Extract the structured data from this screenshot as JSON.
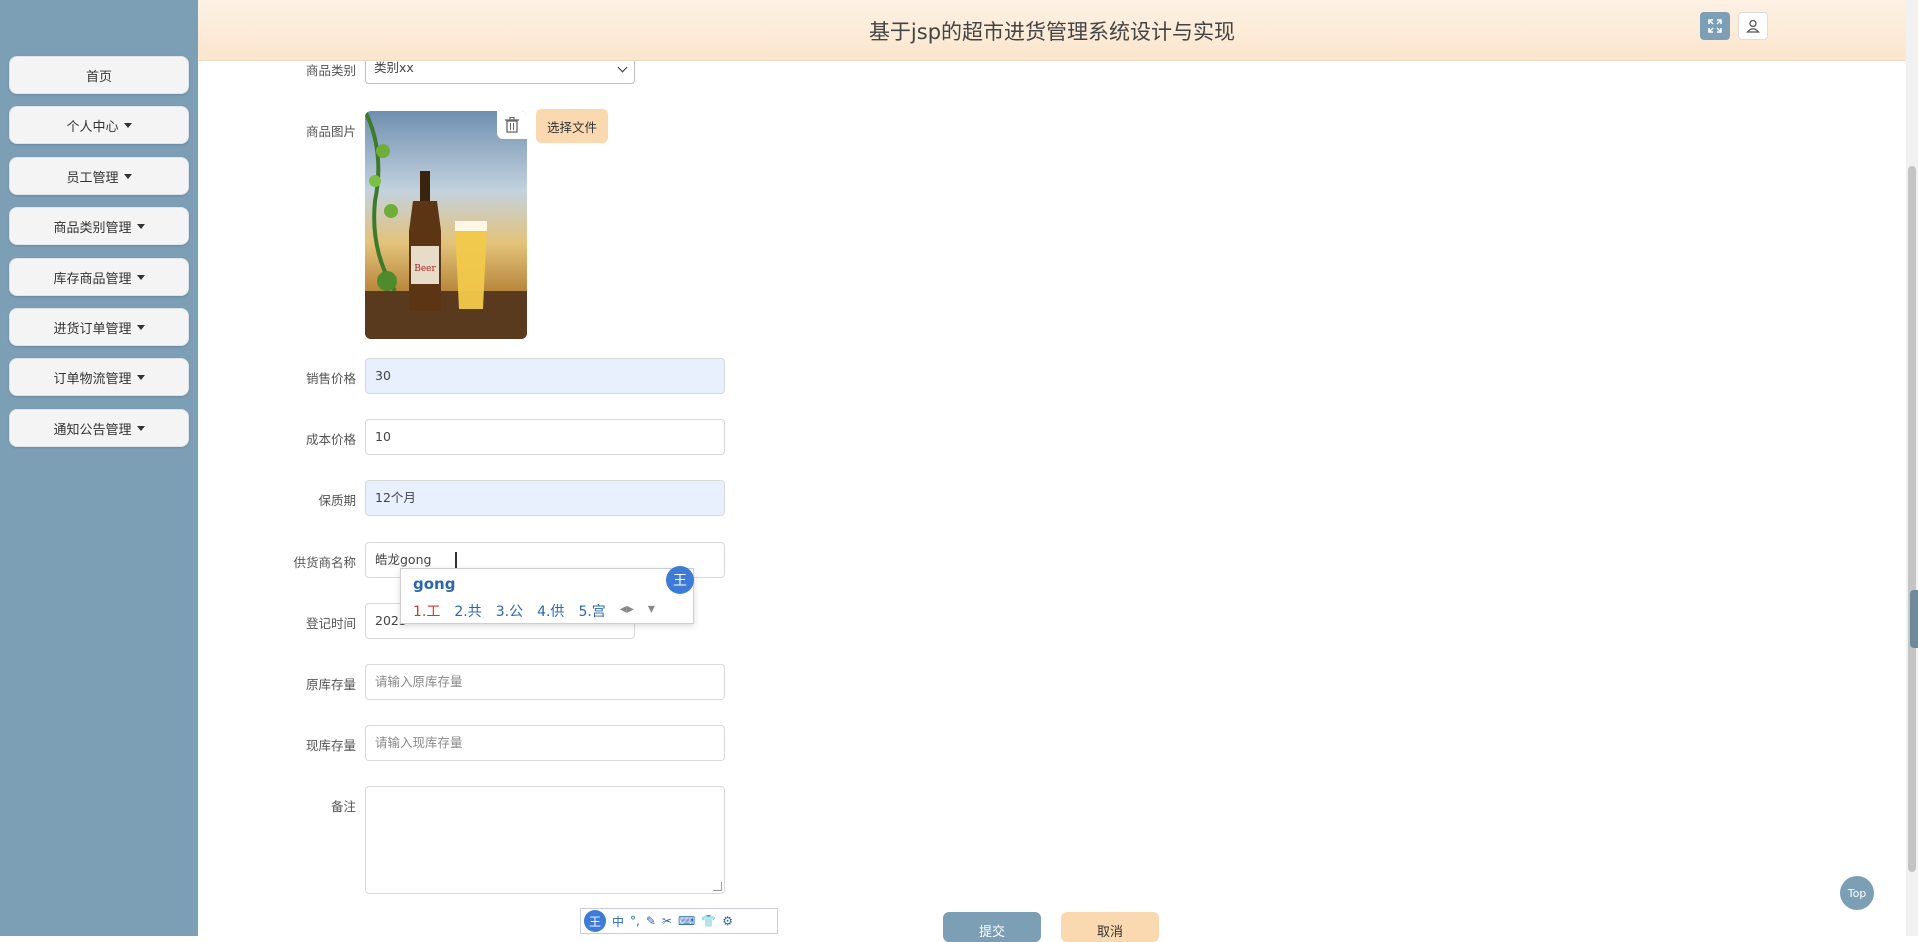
{
  "header": {
    "title": "基于jsp的超市进货管理系统设计与实现",
    "fullscreen_icon": "expand-icon",
    "user_icon": "user-icon"
  },
  "sidebar": {
    "items": [
      {
        "label": "首页",
        "has_caret": false
      },
      {
        "label": "个人中心",
        "has_caret": true
      },
      {
        "label": "员工管理",
        "has_caret": true
      },
      {
        "label": "商品类别管理",
        "has_caret": true
      },
      {
        "label": "库存商品管理",
        "has_caret": true
      },
      {
        "label": "进货订单管理",
        "has_caret": true
      },
      {
        "label": "订单物流管理",
        "has_caret": true
      },
      {
        "label": "通知公告管理",
        "has_caret": true
      }
    ]
  },
  "form": {
    "category": {
      "label": "商品类别",
      "value": "类别xx"
    },
    "image": {
      "label": "商品图片",
      "choose_label": "选择文件",
      "delete_icon": "trash-icon"
    },
    "sale_price": {
      "label": "销售价格",
      "value": "30"
    },
    "cost_price": {
      "label": "成本价格",
      "value": "10"
    },
    "shelf_life": {
      "label": "保质期",
      "value": "12个月"
    },
    "supplier": {
      "label": "供货商名称",
      "value": "皓龙gong"
    },
    "register_time": {
      "label": "登记时间",
      "value": "2023"
    },
    "original_stock": {
      "label": "原库存量",
      "placeholder": "请输入原库存量"
    },
    "current_stock": {
      "label": "现库存量",
      "placeholder": "请输入现库存量"
    },
    "remark": {
      "label": "备注",
      "value": ""
    },
    "submit_label": "提交",
    "cancel_label": "取消"
  },
  "ime": {
    "pinyin": "gong",
    "candidates": [
      "1.工",
      "2.共",
      "3.公",
      "4.供",
      "5.宫"
    ],
    "logo": "王",
    "toolbar": [
      "中",
      "°,",
      "✎",
      "✂",
      "⌨",
      "👕",
      "⚙"
    ]
  },
  "top_button": "Top"
}
